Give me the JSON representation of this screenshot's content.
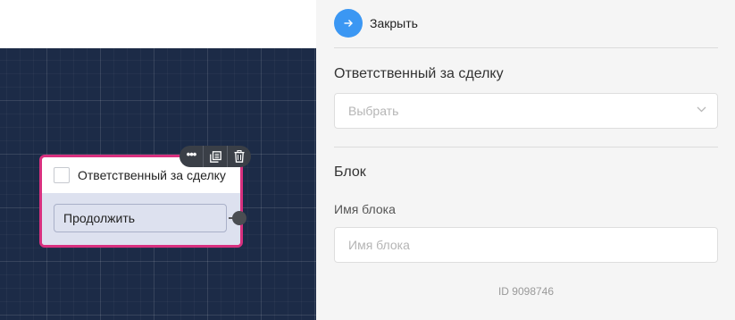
{
  "editor": {
    "node": {
      "title": "Ответственный за сделку",
      "continue_label": "Продолжить"
    },
    "toolbar": {
      "menu_icon": "more-horizontal-icon",
      "copy_icon": "copy-icon",
      "delete_icon": "trash-icon"
    }
  },
  "panel": {
    "close_label": "Закрыть",
    "close_icon": "arrow-right-icon",
    "responsible": {
      "label": "Ответственный за сделку",
      "select_placeholder": "Выбрать",
      "chevron_icon": "chevron-down-icon"
    },
    "block": {
      "heading": "Блок",
      "name_label": "Имя блока",
      "name_placeholder": "Имя блока",
      "name_value": "",
      "id_text": "ID 9098746"
    }
  },
  "colors": {
    "canvas_bg": "#1c2b47",
    "node_border": "#d8307f",
    "node_body": "#dde1ef",
    "accent_blue": "#3b97f3",
    "panel_bg": "#f5f5f5"
  }
}
